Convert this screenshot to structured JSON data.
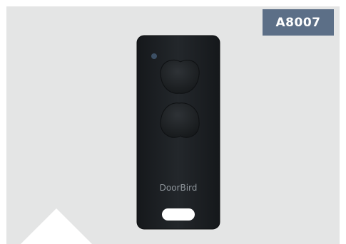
{
  "product": {
    "code": "A8007",
    "brand_mark": "DoorBird",
    "device_name": "key-fob-remote"
  },
  "colors": {
    "background": "#e4e5e5",
    "badge": "#5c6f87",
    "device_body": "#1c1f22"
  }
}
